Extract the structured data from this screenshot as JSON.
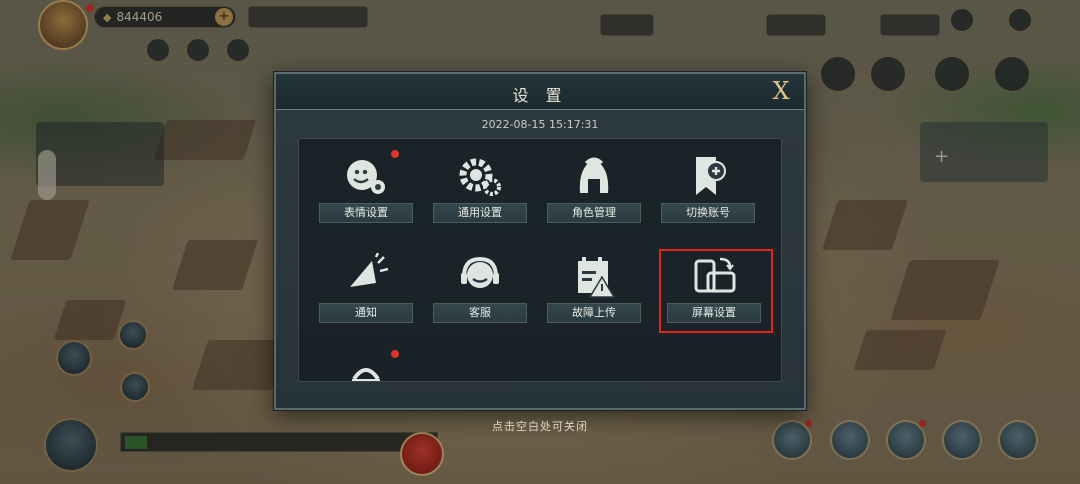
{
  "hud": {
    "resource_value": "844406",
    "plus_symbol": "+"
  },
  "modal": {
    "title": "设 置",
    "close_glyph": "X",
    "timestamp": "2022-08-15  15:17:31",
    "tiles": [
      {
        "label": "表情设置",
        "icon": "emoji-gear-icon",
        "badge": true
      },
      {
        "label": "通用设置",
        "icon": "gears-icon",
        "badge": false
      },
      {
        "label": "角色管理",
        "icon": "helmet-icon",
        "badge": false
      },
      {
        "label": "切换账号",
        "icon": "switch-account-icon",
        "badge": false
      },
      {
        "label": "通知",
        "icon": "megaphone-icon",
        "badge": false
      },
      {
        "label": "客服",
        "icon": "headset-icon",
        "badge": false
      },
      {
        "label": "故障上传",
        "icon": "calendar-warning-icon",
        "badge": false
      },
      {
        "label": "屏幕设置",
        "icon": "screen-rotate-icon",
        "badge": false,
        "highlighted": true
      },
      {
        "label": "",
        "icon": "partial-icon",
        "badge": true
      }
    ]
  },
  "hint": "点击空白处可关闭",
  "colors": {
    "accent_gold": "#e2c489",
    "highlight_red": "#e3231b",
    "badge_red": "#e0332a"
  }
}
